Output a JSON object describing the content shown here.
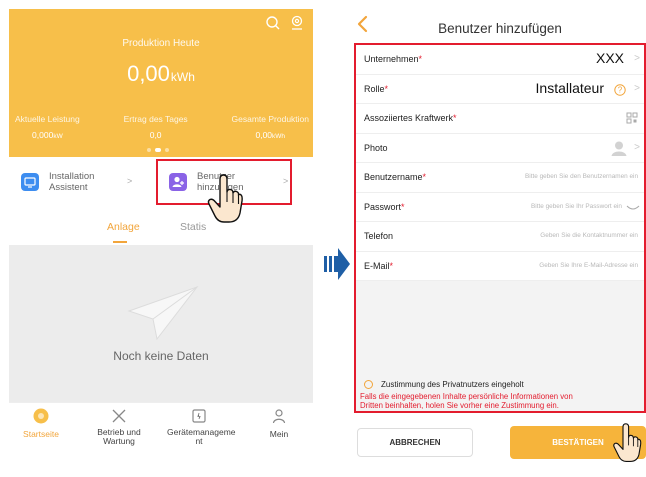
{
  "left_screen": {
    "production": {
      "title": "Produktion Heute",
      "value": "0,00",
      "unit": "kWh"
    },
    "stats": [
      {
        "label": "Aktuelle Leistung",
        "value": "0,000",
        "unit": "kW"
      },
      {
        "label": "Ertrag des Tages",
        "value": "0,0",
        "unit": ""
      },
      {
        "label": "Gesamte Produktion",
        "value": "0,00",
        "unit": "kWh"
      }
    ],
    "quick_actions": [
      {
        "label_line1": "Installation",
        "label_line2": "Assistent",
        "icon": "installation-icon"
      },
      {
        "label_line1": "Benutzer",
        "label_line2": "hinzufügen",
        "icon": "add-user-icon"
      }
    ],
    "tabs": [
      "Anlage",
      "Statis"
    ],
    "empty_text": "Noch keine Daten",
    "bottom_nav": [
      {
        "label_line1": "Startseite",
        "label_line2": "",
        "icon": "home-icon",
        "active": true
      },
      {
        "label_line1": "Betrieb und",
        "label_line2": "Wartung",
        "icon": "tools-icon"
      },
      {
        "label_line1": "Gerätemanageme",
        "label_line2": "nt",
        "icon": "device-icon"
      },
      {
        "label_line1": "Mein",
        "label_line2": "",
        "icon": "user-icon"
      }
    ]
  },
  "right_screen": {
    "title": "Benutzer hinzufügen",
    "fields": [
      {
        "label": "Unternehmen",
        "required": true,
        "value": "XXX",
        "placeholder": ""
      },
      {
        "label": "Rolle",
        "required": true,
        "value": "Installateur",
        "placeholder": ""
      },
      {
        "label": "Assoziiertes Kraftwerk",
        "required": true,
        "value": "",
        "placeholder": ""
      },
      {
        "label": "Photo",
        "required": false,
        "value": "",
        "placeholder": ""
      },
      {
        "label": "Benutzername",
        "required": true,
        "value": "",
        "placeholder": "Bitte geben Sie den Benutzernamen ein"
      },
      {
        "label": "Passwort",
        "required": true,
        "value": "",
        "placeholder": "Bitte geben Sie Ihr Passwort ein"
      },
      {
        "label": "Telefon",
        "required": false,
        "value": "",
        "placeholder": "Geben Sie die Kontaktnummer ein"
      },
      {
        "label": "E-Mail",
        "required": true,
        "value": "",
        "placeholder": "Geben Sie Ihre E-Mail-Adresse ein"
      }
    ],
    "consent": "Zustimmung des Privatnutzers eingeholt",
    "consent_warning_line1": "Falls die eingegebenen Inhalte persönliche Informationen von",
    "consent_warning_line2": "Dritten beinhalten, holen Sie vorher eine Zustimmung ein.",
    "cancel_label": "ABBRECHEN",
    "confirm_label": "BESTÄTIGEN"
  },
  "colors": {
    "accent": "#f7bf4a",
    "highlight": "#e31c2e",
    "arrow": "#1f5fa6"
  }
}
